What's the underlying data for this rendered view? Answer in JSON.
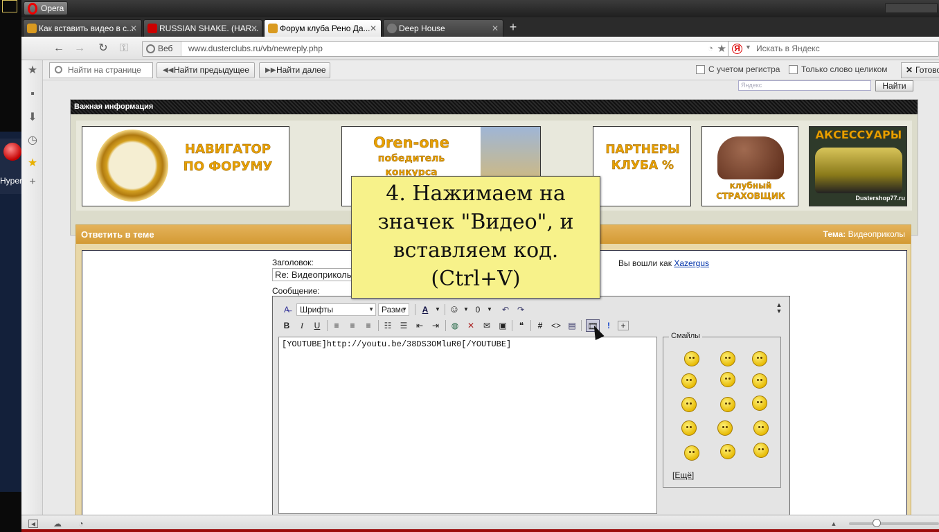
{
  "desktop": {
    "gadget_label": "Hyper"
  },
  "titlebar": {
    "menu_label": "Opera"
  },
  "tabs": [
    {
      "title": "Как вставить видео в с...",
      "favicon_color": "#d99a20"
    },
    {
      "title": "RUSSIAN SHAKE. (HAR...",
      "favicon_color": "#cc0000"
    },
    {
      "title": "Форум клуба Рено Да...",
      "favicon_color": "#d99a20",
      "active": true
    },
    {
      "title": "Deep House",
      "favicon_color": "#777777"
    }
  ],
  "tab_add": "+",
  "address_bar": {
    "scope_label": "Веб",
    "url": "www.dusterclubs.ru/vb/newreply.php",
    "search_placeholder": "Искать в Яндекс",
    "search_engine_letter": "Я"
  },
  "find_bar": {
    "placeholder": "Найти на странице",
    "prev_label": "Найти предыдущее",
    "next_label": "Найти далее",
    "case_label": "С учетом регистра",
    "whole_word_label": "Только слово целиком",
    "close_label": "Готово"
  },
  "page": {
    "yandex_placeholder": "Яндекс",
    "yandex_button": "Найти",
    "info_header": "Важная информация",
    "banners": {
      "navigator": "НАВИГАТОР ПО ФОРУМУ",
      "oren_title": "Oren-one",
      "oren_sub": "победитель конкурса",
      "partners": "ПАРТНЕРЫ КЛУБА %",
      "insurer": "клубный СТРАХОВЩИК",
      "accessories": "АКСЕССУАРЫ",
      "shop": "Dustershop77.ru"
    },
    "reply": {
      "header": "Ответить в теме",
      "theme_label": "Тема:",
      "theme_value": "Видеоприколы",
      "title_label": "Заголовок:",
      "title_value": "Re: Видеоприколы",
      "logged_as": "Вы вошли как",
      "username": "Xazergus",
      "message_label": "Сообщение:"
    },
    "editor": {
      "font_select": "Шрифты",
      "size_select": "Разме",
      "message_text": "[YOUTUBE]http://youtu.be/38DS3OMluR0[/YOUTUBE]",
      "smilies_legend": "Смайлы",
      "more_link": "Ещё"
    }
  },
  "tooltip": {
    "lines": [
      "4. Нажимаем на",
      "значек \"Видео\", и",
      "вставляем код.",
      "(Ctrl+V)"
    ]
  }
}
